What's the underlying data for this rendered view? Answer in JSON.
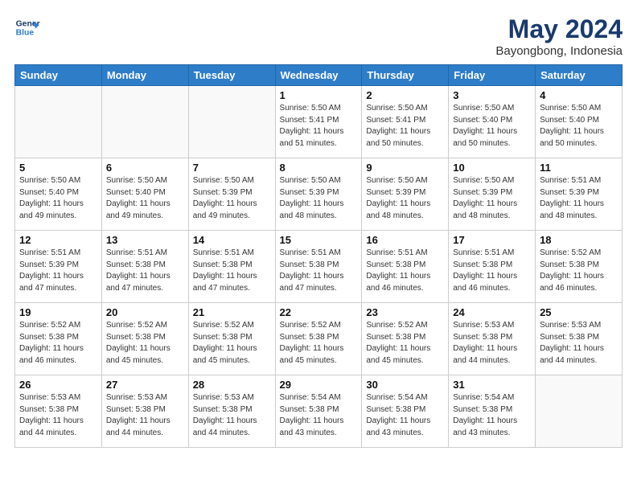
{
  "logo": {
    "line1": "General",
    "line2": "Blue"
  },
  "title": "May 2024",
  "location": "Bayongbong, Indonesia",
  "days_of_week": [
    "Sunday",
    "Monday",
    "Tuesday",
    "Wednesday",
    "Thursday",
    "Friday",
    "Saturday"
  ],
  "weeks": [
    [
      {
        "num": "",
        "info": ""
      },
      {
        "num": "",
        "info": ""
      },
      {
        "num": "",
        "info": ""
      },
      {
        "num": "1",
        "info": "Sunrise: 5:50 AM\nSunset: 5:41 PM\nDaylight: 11 hours\nand 51 minutes."
      },
      {
        "num": "2",
        "info": "Sunrise: 5:50 AM\nSunset: 5:41 PM\nDaylight: 11 hours\nand 50 minutes."
      },
      {
        "num": "3",
        "info": "Sunrise: 5:50 AM\nSunset: 5:40 PM\nDaylight: 11 hours\nand 50 minutes."
      },
      {
        "num": "4",
        "info": "Sunrise: 5:50 AM\nSunset: 5:40 PM\nDaylight: 11 hours\nand 50 minutes."
      }
    ],
    [
      {
        "num": "5",
        "info": "Sunrise: 5:50 AM\nSunset: 5:40 PM\nDaylight: 11 hours\nand 49 minutes."
      },
      {
        "num": "6",
        "info": "Sunrise: 5:50 AM\nSunset: 5:40 PM\nDaylight: 11 hours\nand 49 minutes."
      },
      {
        "num": "7",
        "info": "Sunrise: 5:50 AM\nSunset: 5:39 PM\nDaylight: 11 hours\nand 49 minutes."
      },
      {
        "num": "8",
        "info": "Sunrise: 5:50 AM\nSunset: 5:39 PM\nDaylight: 11 hours\nand 48 minutes."
      },
      {
        "num": "9",
        "info": "Sunrise: 5:50 AM\nSunset: 5:39 PM\nDaylight: 11 hours\nand 48 minutes."
      },
      {
        "num": "10",
        "info": "Sunrise: 5:50 AM\nSunset: 5:39 PM\nDaylight: 11 hours\nand 48 minutes."
      },
      {
        "num": "11",
        "info": "Sunrise: 5:51 AM\nSunset: 5:39 PM\nDaylight: 11 hours\nand 48 minutes."
      }
    ],
    [
      {
        "num": "12",
        "info": "Sunrise: 5:51 AM\nSunset: 5:39 PM\nDaylight: 11 hours\nand 47 minutes."
      },
      {
        "num": "13",
        "info": "Sunrise: 5:51 AM\nSunset: 5:38 PM\nDaylight: 11 hours\nand 47 minutes."
      },
      {
        "num": "14",
        "info": "Sunrise: 5:51 AM\nSunset: 5:38 PM\nDaylight: 11 hours\nand 47 minutes."
      },
      {
        "num": "15",
        "info": "Sunrise: 5:51 AM\nSunset: 5:38 PM\nDaylight: 11 hours\nand 47 minutes."
      },
      {
        "num": "16",
        "info": "Sunrise: 5:51 AM\nSunset: 5:38 PM\nDaylight: 11 hours\nand 46 minutes."
      },
      {
        "num": "17",
        "info": "Sunrise: 5:51 AM\nSunset: 5:38 PM\nDaylight: 11 hours\nand 46 minutes."
      },
      {
        "num": "18",
        "info": "Sunrise: 5:52 AM\nSunset: 5:38 PM\nDaylight: 11 hours\nand 46 minutes."
      }
    ],
    [
      {
        "num": "19",
        "info": "Sunrise: 5:52 AM\nSunset: 5:38 PM\nDaylight: 11 hours\nand 46 minutes."
      },
      {
        "num": "20",
        "info": "Sunrise: 5:52 AM\nSunset: 5:38 PM\nDaylight: 11 hours\nand 45 minutes."
      },
      {
        "num": "21",
        "info": "Sunrise: 5:52 AM\nSunset: 5:38 PM\nDaylight: 11 hours\nand 45 minutes."
      },
      {
        "num": "22",
        "info": "Sunrise: 5:52 AM\nSunset: 5:38 PM\nDaylight: 11 hours\nand 45 minutes."
      },
      {
        "num": "23",
        "info": "Sunrise: 5:52 AM\nSunset: 5:38 PM\nDaylight: 11 hours\nand 45 minutes."
      },
      {
        "num": "24",
        "info": "Sunrise: 5:53 AM\nSunset: 5:38 PM\nDaylight: 11 hours\nand 44 minutes."
      },
      {
        "num": "25",
        "info": "Sunrise: 5:53 AM\nSunset: 5:38 PM\nDaylight: 11 hours\nand 44 minutes."
      }
    ],
    [
      {
        "num": "26",
        "info": "Sunrise: 5:53 AM\nSunset: 5:38 PM\nDaylight: 11 hours\nand 44 minutes."
      },
      {
        "num": "27",
        "info": "Sunrise: 5:53 AM\nSunset: 5:38 PM\nDaylight: 11 hours\nand 44 minutes."
      },
      {
        "num": "28",
        "info": "Sunrise: 5:53 AM\nSunset: 5:38 PM\nDaylight: 11 hours\nand 44 minutes."
      },
      {
        "num": "29",
        "info": "Sunrise: 5:54 AM\nSunset: 5:38 PM\nDaylight: 11 hours\nand 43 minutes."
      },
      {
        "num": "30",
        "info": "Sunrise: 5:54 AM\nSunset: 5:38 PM\nDaylight: 11 hours\nand 43 minutes."
      },
      {
        "num": "31",
        "info": "Sunrise: 5:54 AM\nSunset: 5:38 PM\nDaylight: 11 hours\nand 43 minutes."
      },
      {
        "num": "",
        "info": ""
      }
    ]
  ]
}
